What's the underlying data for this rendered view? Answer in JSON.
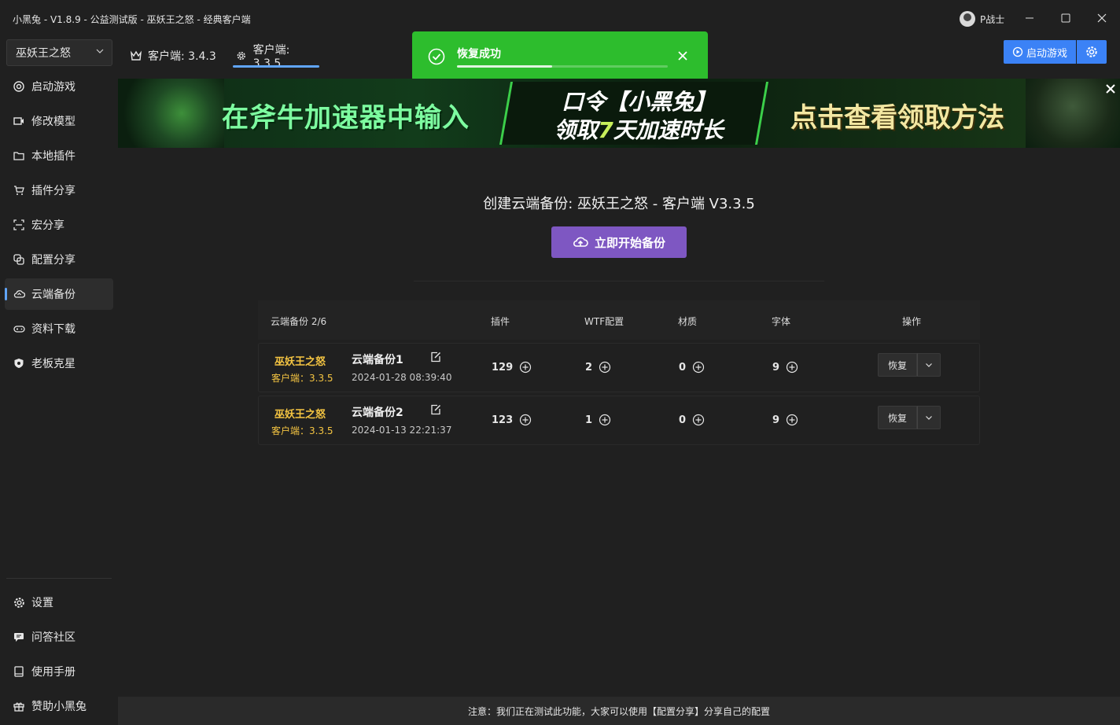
{
  "window": {
    "title": "小黑兔 - V1.8.9 - 公益测试版 - 巫妖王之怒 - 经典客户端",
    "user": "P战士"
  },
  "game_select": {
    "value": "巫妖王之怒"
  },
  "tabs": [
    {
      "label": "客户端: 3.4.3",
      "icon": "crown-icon"
    },
    {
      "label": "客户端: 3.3.5",
      "icon": "gear-icon",
      "active": true
    }
  ],
  "sidebar": {
    "items": [
      {
        "label": "启动游戏",
        "icon": "target-icon"
      },
      {
        "label": "修改模型",
        "icon": "camera-icon"
      },
      {
        "label": "本地插件",
        "icon": "folder-icon"
      },
      {
        "label": "插件分享",
        "icon": "cart-icon"
      },
      {
        "label": "宏分享",
        "icon": "scan-icon"
      },
      {
        "label": "配置分享",
        "icon": "copy-icon"
      },
      {
        "label": "云端备份",
        "icon": "cloud-icon",
        "active": true
      },
      {
        "label": "资料下载",
        "icon": "gamepad-icon"
      },
      {
        "label": "老板克星",
        "icon": "shield-icon"
      }
    ],
    "bottom_items": [
      {
        "label": "设置",
        "icon": "gear-icon"
      },
      {
        "label": "问答社区",
        "icon": "chat-icon"
      },
      {
        "label": "使用手册",
        "icon": "book-icon"
      },
      {
        "label": "赞助小黑兔",
        "icon": "gift-icon"
      }
    ]
  },
  "toast": {
    "message": "恢复成功",
    "progress": 0.45,
    "color": "#2dbd2d"
  },
  "toolbar": {
    "launch_label": "启动游戏",
    "accent": "#3b82f6"
  },
  "banner": {
    "text_left": "在斧牛加速器中输入",
    "text_mid_top": "口令【小黑兔】",
    "text_mid_bottom_pre": "领取",
    "text_mid_bottom_hl": "7",
    "text_mid_bottom_post": "天加速时长",
    "text_right": "点击查看领取方法"
  },
  "backup": {
    "title": "创建云端备份: 巫妖王之怒 - 客户端 V3.3.5",
    "button_label": "立即开始备份",
    "button_color": "#7e57c2"
  },
  "table": {
    "headers": {
      "name": "云端备份 2/6",
      "addons": "插件",
      "wtf": "WTF配置",
      "textures": "材质",
      "fonts": "字体",
      "actions": "操作"
    },
    "rows": [
      {
        "game": "巫妖王之怒",
        "client": "客户端：3.3.5",
        "name": "云端备份1",
        "date": "2024-01-28 08:39:40",
        "addons": "129",
        "wtf": "2",
        "textures": "0",
        "fonts": "9",
        "restore_label": "恢复"
      },
      {
        "game": "巫妖王之怒",
        "client": "客户端：3.3.5",
        "name": "云端备份2",
        "date": "2024-01-13 22:21:37",
        "addons": "123",
        "wtf": "1",
        "textures": "0",
        "fonts": "9",
        "restore_label": "恢复"
      }
    ]
  },
  "footer": {
    "notice": "注意：我们正在测试此功能，大家可以使用【配置分享】分享自己的配置"
  }
}
